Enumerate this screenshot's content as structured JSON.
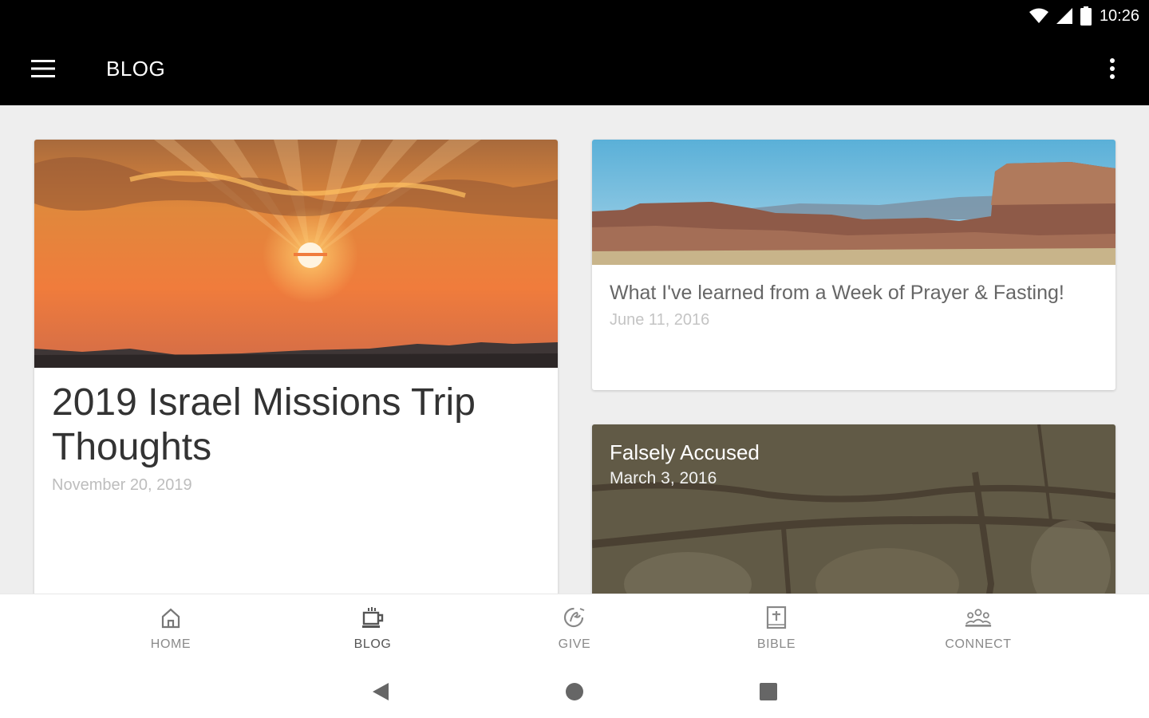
{
  "status_bar": {
    "time": "10:26",
    "icons": [
      "wifi-icon",
      "signal-icon",
      "battery-icon"
    ]
  },
  "app_bar": {
    "title": "BLOG",
    "menu_icon": "hamburger-menu-icon",
    "overflow_icon": "more-vert-icon"
  },
  "posts": [
    {
      "title": "2019 Israel Missions Trip Thoughts",
      "date": "November 20, 2019",
      "image": "sunset"
    },
    {
      "title": "What I've learned from a Week of Prayer & Fasting!",
      "date": "June 11, 2016",
      "image": "canyon"
    },
    {
      "title": "Falsely Accused",
      "date": "March 3, 2016",
      "image": "stone-wall"
    }
  ],
  "bottom_nav": {
    "active": "BLOG",
    "items": [
      {
        "label": "HOME",
        "icon": "home-icon"
      },
      {
        "label": "BLOG",
        "icon": "coffee-cup-icon"
      },
      {
        "label": "GIVE",
        "icon": "give-hand-icon"
      },
      {
        "label": "BIBLE",
        "icon": "bible-icon"
      },
      {
        "label": "CONNECT",
        "icon": "people-icon"
      }
    ]
  },
  "system_nav": {
    "icons": [
      "back-icon",
      "home-circle-icon",
      "recents-icon"
    ]
  },
  "colors": {
    "app_bar_bg": "#000000",
    "content_bg": "#eeeeee",
    "card_bg": "#ffffff",
    "nav_label": "#8a8a8a"
  }
}
